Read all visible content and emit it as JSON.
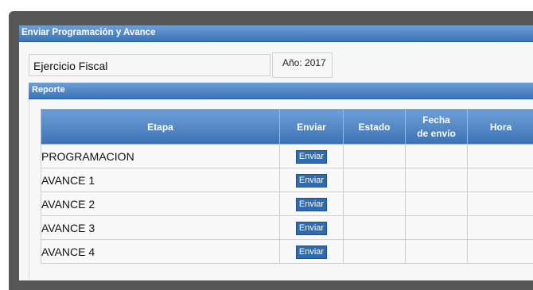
{
  "window": {
    "title": "Enviar Programación y Avance"
  },
  "fiscal": {
    "label": "Ejercicio Fiscal",
    "value": "Año: 2017"
  },
  "report": {
    "title": "Reporte",
    "columns": [
      "Etapa",
      "Enviar",
      "Estado",
      "Fecha de envío",
      "Hora"
    ],
    "rows": [
      {
        "etapa": "PROGRAMACION",
        "button": "Enviar",
        "estado": "",
        "fecha": "",
        "hora": ""
      },
      {
        "etapa": "AVANCE 1",
        "button": "Enviar",
        "estado": "",
        "fecha": "",
        "hora": ""
      },
      {
        "etapa": "AVANCE 2",
        "button": "Enviar",
        "estado": "",
        "fecha": "",
        "hora": ""
      },
      {
        "etapa": "AVANCE 3",
        "button": "Enviar",
        "estado": "",
        "fecha": "",
        "hora": ""
      },
      {
        "etapa": "AVANCE 4",
        "button": "Enviar",
        "estado": "",
        "fecha": "",
        "hora": ""
      }
    ]
  },
  "colors": {
    "header_blue": "#3c73b6",
    "frame_gray": "#575757",
    "button_blue": "#2e6bb0"
  }
}
